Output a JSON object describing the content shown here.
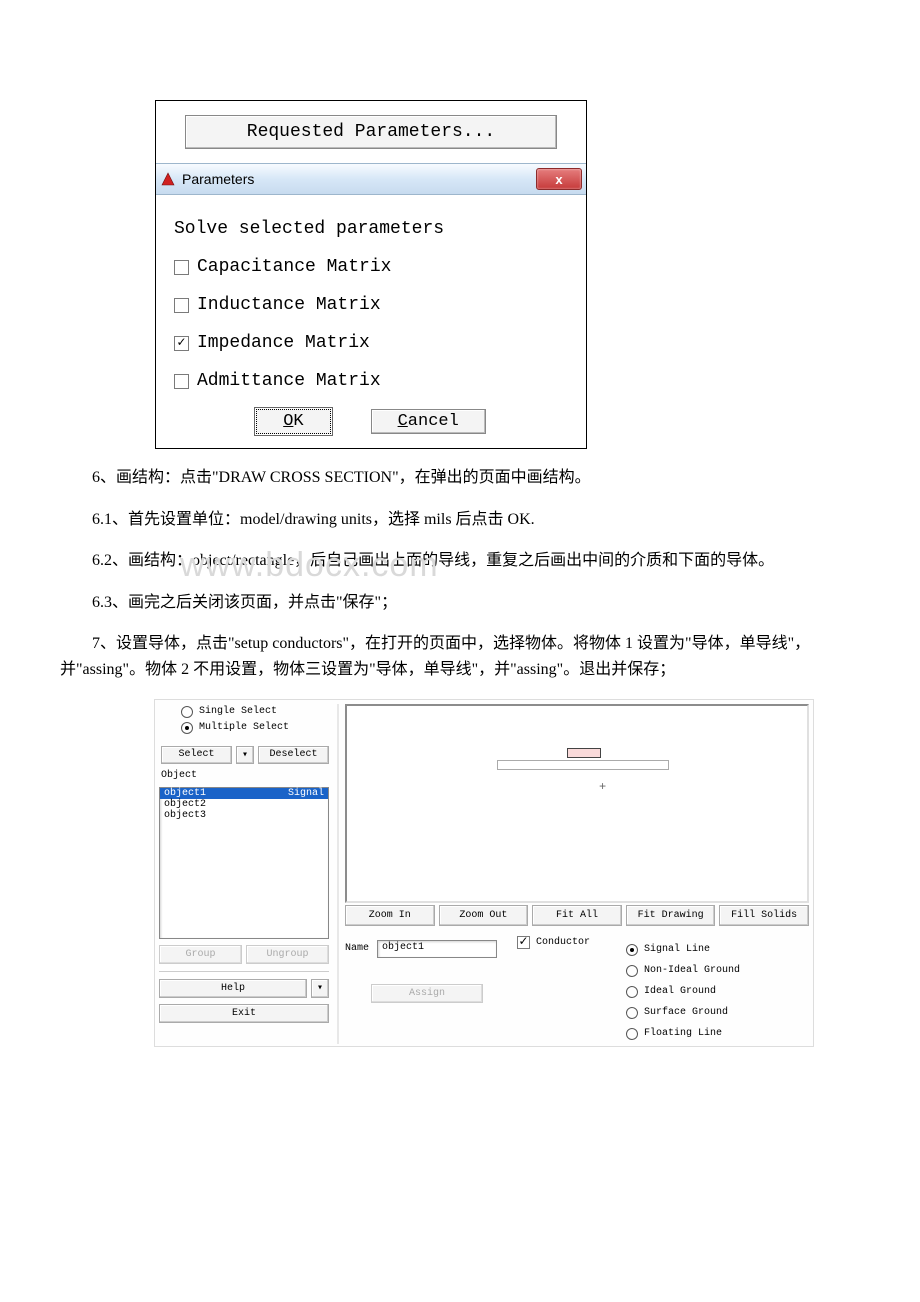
{
  "dialog1": {
    "req_params_btn": "Requested Parameters...",
    "title": "Parameters",
    "close_glyph": "x",
    "heading": "Solve selected parameters",
    "options": [
      {
        "label": "Capacitance Matrix",
        "checked": false
      },
      {
        "label": "Inductance Matrix",
        "checked": false
      },
      {
        "label": "Impedance Matrix",
        "checked": true
      },
      {
        "label": "Admittance Matrix",
        "checked": false
      }
    ],
    "ok": "OK",
    "ok_mnemonic": "O",
    "ok_rest": "K",
    "cancel": "Cancel",
    "cancel_mnemonic": "C",
    "cancel_rest": "ancel"
  },
  "text": {
    "p6": "6、画结构：点击\"DRAW CROSS SECTION\"，在弹出的页面中画结构。",
    "p61": "6.1、首先设置单位：model/drawing units，选择 mils 后点击 OK.",
    "p62": "6.2、画结构：object/rectangle，后自己画出上面的导线，重复之后画出中间的介质和下面的导体。",
    "p63": "6.3、画完之后关闭该页面，并点击\"保存\"；",
    "p7": "7、设置导体，点击\"setup conductors\"，在打开的页面中，选择物体。将物体 1 设置为\"导体，单导线\"，并\"assing\"。物体 2 不用设置，物体三设置为\"导体，单导线\"，并\"assing\"。退出并保存；",
    "watermark": "www.bdocx.com"
  },
  "shot2": {
    "select_modes": {
      "single": "Single Select",
      "multiple": "Multiple Select",
      "selected": "multiple"
    },
    "select_btn": "Select",
    "deselect_btn": "Deselect",
    "object_label": "Object",
    "objects": [
      {
        "name": "object1",
        "role": "Signal",
        "selected": true
      },
      {
        "name": "object2",
        "role": "",
        "selected": false
      },
      {
        "name": "object3",
        "role": "",
        "selected": false
      }
    ],
    "group_btn": "Group",
    "ungroup_btn": "Ungroup",
    "help_btn": "Help",
    "exit_btn": "Exit",
    "canvas_plus": "+",
    "zoom_btns": [
      "Zoom In",
      "Zoom Out",
      "Fit All",
      "Fit Drawing",
      "Fill Solids"
    ],
    "name_label": "Name",
    "name_value": "object1",
    "conductor_label": "Conductor",
    "conductor_checked": true,
    "conductor_types": [
      {
        "label": "Signal Line",
        "checked": true
      },
      {
        "label": "Non-Ideal Ground",
        "checked": false
      },
      {
        "label": "Ideal Ground",
        "checked": false
      },
      {
        "label": "Surface Ground",
        "checked": false
      },
      {
        "label": "Floating Line",
        "checked": false
      }
    ],
    "assign_btn": "Assign"
  }
}
